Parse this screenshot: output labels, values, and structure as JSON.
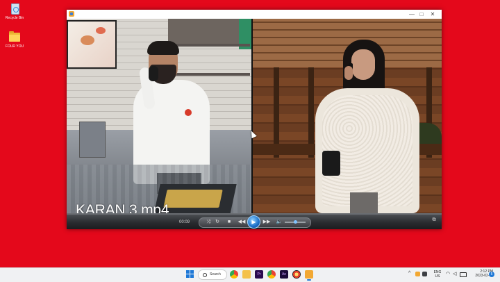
{
  "desktop": {
    "icons": [
      {
        "label": "Recycle Bin"
      },
      {
        "label": "FOUR YOU"
      }
    ]
  },
  "player": {
    "window_controls": {
      "minimize": "—",
      "maximize": "□",
      "close": "✕"
    },
    "video_caption": "KARAN 3.mp4",
    "controls": {
      "time": "00:09",
      "shuffle": "⤨",
      "repeat": "↻",
      "stop": "■",
      "prev": "◀◀",
      "play": "▶",
      "next": "▶▶",
      "volume": "🔈",
      "switch_view": "⧉",
      "volume_level_percent": 50
    }
  },
  "taskbar": {
    "search_label": "Search",
    "apps": [
      "chrome",
      "file-explorer",
      "premiere-pro",
      "chrome",
      "after-effects",
      "media",
      "media-player"
    ],
    "premiere_label": "Pr",
    "aftereffects_label": "Ae",
    "tray": {
      "chevron": "^",
      "lang_line1": "ENG",
      "lang_line2": "US",
      "time": "2:12 PM",
      "date": "2023-02-07",
      "notifications": "5"
    }
  }
}
